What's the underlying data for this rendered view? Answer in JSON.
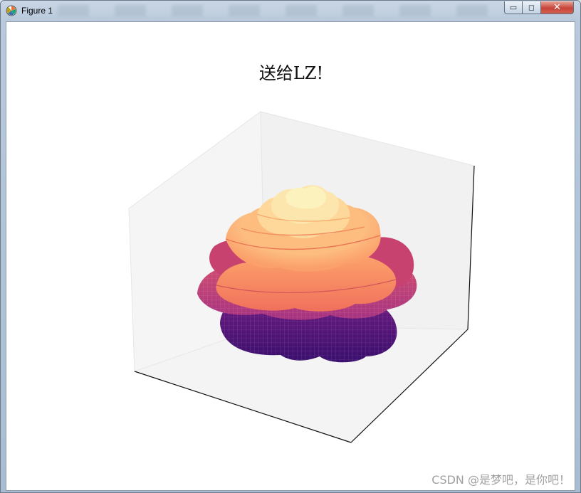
{
  "window": {
    "title": "Figure 1",
    "controls": {
      "minimize": "▭",
      "maximize": "◻",
      "close": "✕"
    }
  },
  "figure": {
    "title": "送给LZ!",
    "colormap": "magma",
    "axes_3d": {
      "pane_color": "#f2f2f2",
      "panes_visible": true,
      "ticks_visible": false
    },
    "surface_colors": [
      "#fcfdbf",
      "#fec287",
      "#fb8761",
      "#e55c5c",
      "#b73779",
      "#8c2981",
      "#641a80",
      "#3b0f70"
    ]
  },
  "watermark": "CSDN @是梦吧，是你吧！"
}
